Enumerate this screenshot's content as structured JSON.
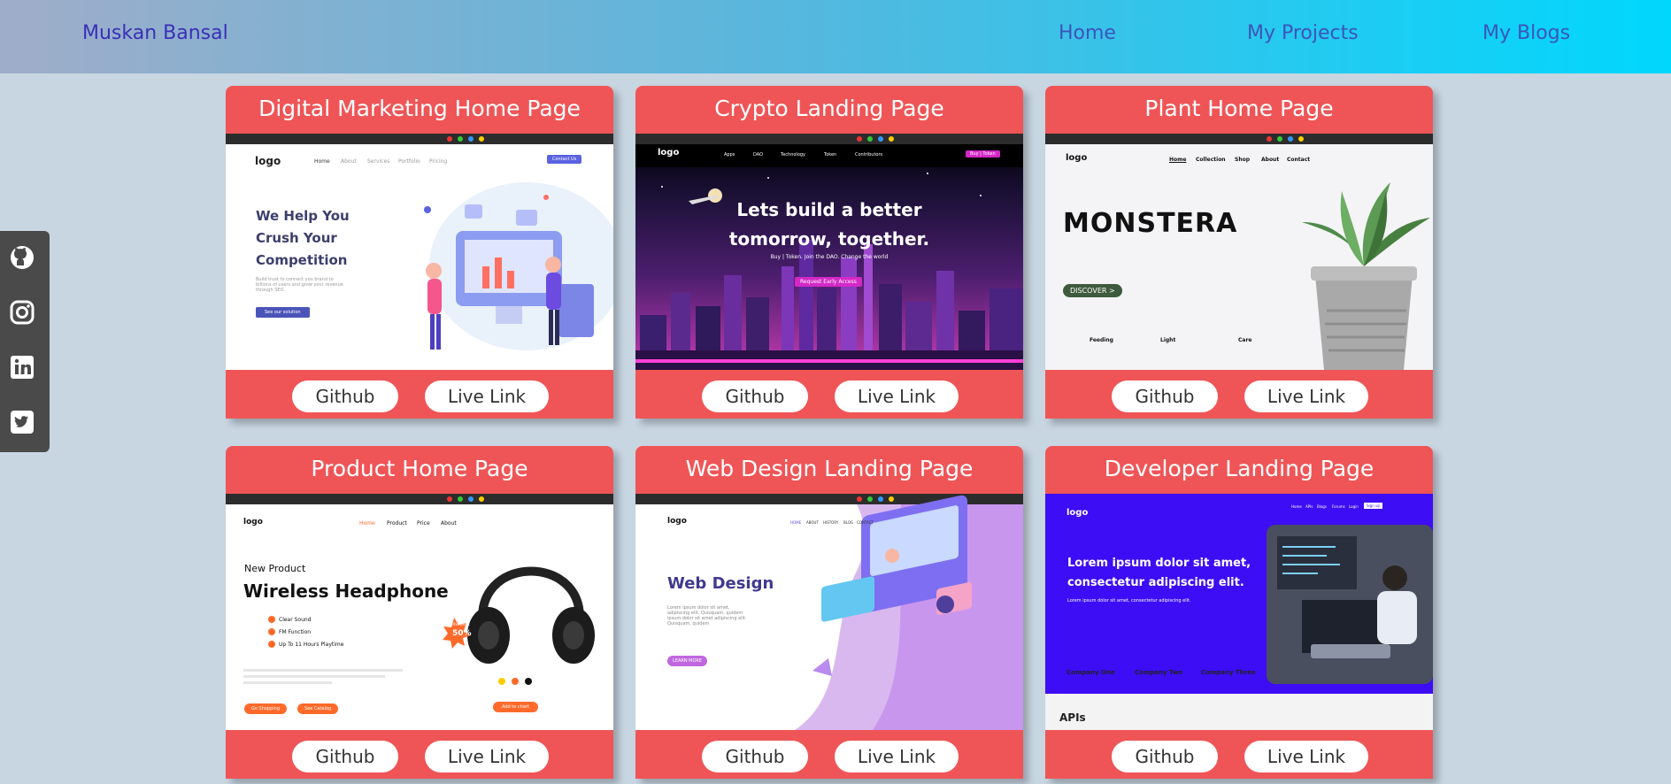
{
  "nav": {
    "brand": "Muskan Bansal",
    "links": [
      "Home",
      "My Projects",
      "My Blogs"
    ]
  },
  "social": [
    "github-icon",
    "instagram-icon",
    "linkedin-icon",
    "twitter-icon"
  ],
  "button_labels": {
    "github": "Github",
    "live": "Live Link"
  },
  "projects": [
    {
      "title": "Digital Marketing Home Page",
      "shot": {
        "logo": "logo",
        "menu": [
          "Home",
          "About",
          "Services",
          "Portfolio",
          "Pricing"
        ],
        "cta": "Contact Us",
        "headline": [
          "We Help You",
          "Crush Your",
          "Competition"
        ],
        "body": "Build trust to connect you brand to billions of users and grow your revenue through SEO.",
        "button": "See our solution"
      }
    },
    {
      "title": "Crypto Landing Page",
      "shot": {
        "logo": "logo",
        "menu": [
          "Apps",
          "DAO",
          "Technology",
          "Token",
          "Contributors"
        ],
        "cta": "Buy | Token",
        "headline": [
          "Lets build a better",
          "tomorrow, together."
        ],
        "body": "Buy | Token. Join the DAO. Change the world",
        "button": "Request Early Access"
      }
    },
    {
      "title": "Plant Home Page",
      "shot": {
        "logo": "logo",
        "menu": [
          "Home",
          "Collection",
          "Shop",
          "About",
          "Contact"
        ],
        "headline": [
          "MONSTERA"
        ],
        "button": "DISCOVER >",
        "features": [
          "Feeding",
          "Light",
          "Care"
        ]
      }
    },
    {
      "title": "Product Home Page",
      "shot": {
        "logo": "logo",
        "menu": [
          "Home",
          "Product",
          "Price",
          "About"
        ],
        "kicker": "New Product",
        "headline": [
          "Wireless Headphone"
        ],
        "bullets": [
          "Clear Sound",
          "FM Function",
          "Up To 11 Hours Playtime"
        ],
        "badge": [
          "Discount",
          "50%"
        ],
        "buttons": [
          "Go Shopping",
          "See Catalog",
          "Add to chart"
        ]
      }
    },
    {
      "title": "Web Design Landing Page",
      "shot": {
        "logo": "logo",
        "menu": [
          "HOME",
          "ABOUT",
          "HISTORY",
          "BLOG",
          "CONTACT"
        ],
        "headline": [
          "Web Design"
        ],
        "body": "Lorem ipsum dolor sit amet, adipiscing elit. Quisquam, quidem ipsum dolor sit amet adipiscing elit. Quisquam, quidem",
        "button": "LEARN MORE"
      }
    },
    {
      "title": "Developer Landing Page",
      "shot": {
        "logo": "logo",
        "menu": [
          "Home",
          "APIs",
          "Blogs",
          "Forums",
          "Login",
          "Sign up"
        ],
        "headline": [
          "Lorem ipsum dolor sit amet,",
          "consectetur adipiscing elit."
        ],
        "body": "Lorem ipsum dolor sit amet, consectetur adipiscing elit.",
        "companies": [
          "Company One",
          "Company Two",
          "Company Three"
        ],
        "section": "APIs"
      }
    }
  ]
}
